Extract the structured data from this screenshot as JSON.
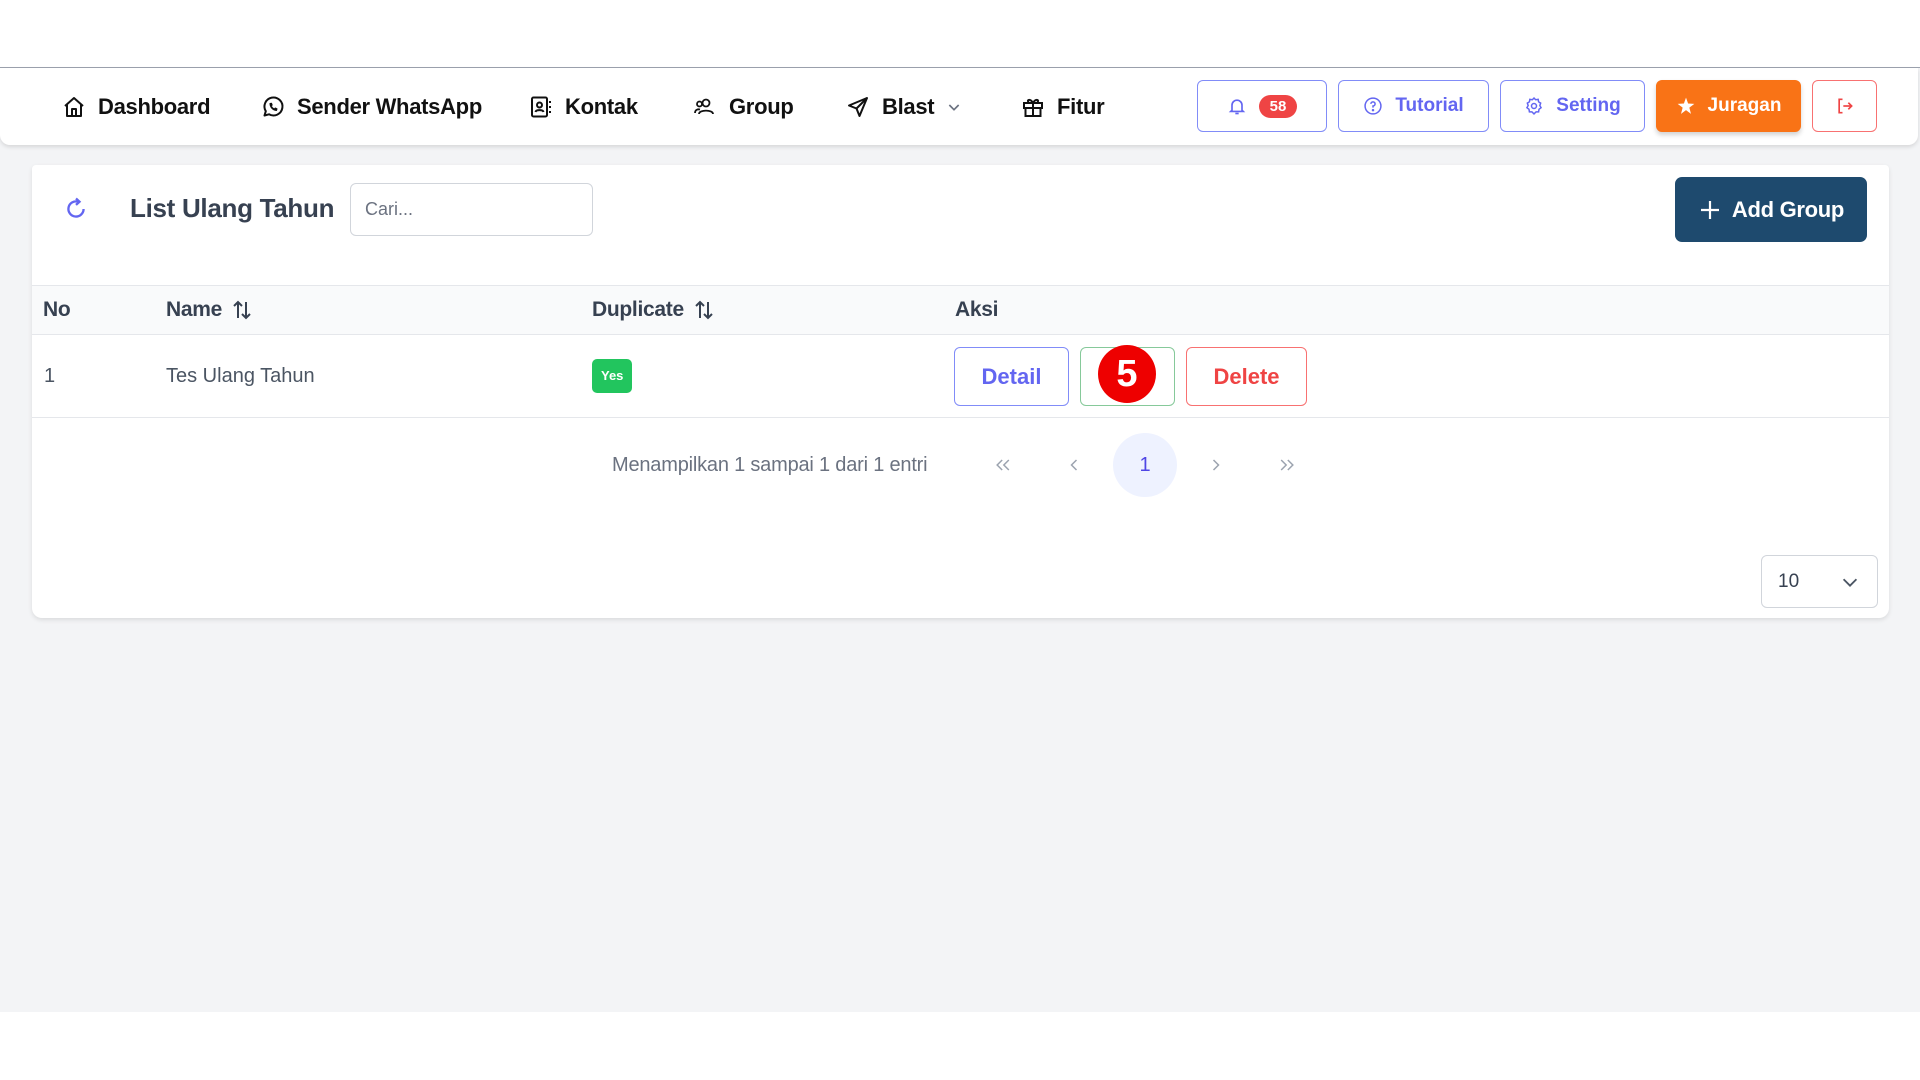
{
  "nav": {
    "items": [
      {
        "label": "Dashboard",
        "icon": "home-icon"
      },
      {
        "label": "Sender WhatsApp",
        "icon": "whatsapp-icon"
      },
      {
        "label": "Kontak",
        "icon": "contact-book-icon"
      },
      {
        "label": "Group",
        "icon": "users-icon"
      },
      {
        "label": "Blast",
        "icon": "send-icon",
        "has_dropdown": true
      },
      {
        "label": "Fitur",
        "icon": "gift-icon"
      }
    ],
    "notifications": {
      "count": "58"
    },
    "tutorial_label": "Tutorial",
    "setting_label": "Setting",
    "juragan_label": "Juragan"
  },
  "page": {
    "title": "List Ulang Tahun",
    "search_placeholder": "Cari...",
    "search_value": "",
    "add_button_label": "Add Group"
  },
  "table": {
    "columns": [
      {
        "label": "No",
        "sortable": false
      },
      {
        "label": "Name",
        "sortable": true
      },
      {
        "label": "Duplicate",
        "sortable": true
      },
      {
        "label": "Aksi",
        "sortable": false
      }
    ],
    "rows": [
      {
        "no": "1",
        "name": "Tes Ulang Tahun",
        "duplicate": "Yes",
        "actions": {
          "detail": "Detail",
          "edit": "",
          "delete": "Delete"
        }
      }
    ]
  },
  "annotation": {
    "step_number": "5"
  },
  "pagination": {
    "info": "Menampilkan 1 sampai 1 dari 1 entri",
    "current_page": "1",
    "page_size": "10"
  },
  "colors": {
    "accent": "#6366f1",
    "primary_dark": "#1e4a6e",
    "juragan": "#f97316",
    "danger": "#ef4444",
    "success": "#22c55e"
  }
}
